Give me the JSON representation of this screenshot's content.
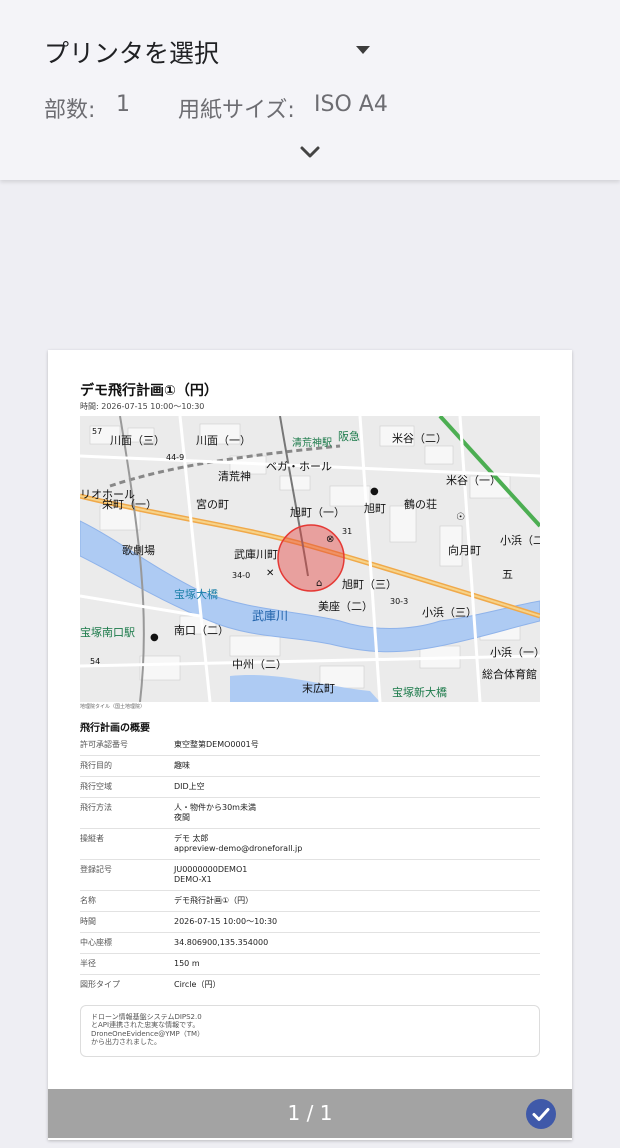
{
  "header": {
    "printer_label": "プリンタを選択",
    "copies_label": "部数:",
    "copies_value": "1",
    "paper_label": "用紙サイズ:",
    "paper_value": "ISO A4"
  },
  "icons": {
    "dropdown": "caret-down-icon",
    "expand": "chevron-down-icon",
    "select": "check-circle-icon"
  },
  "colors": {
    "accent": "#3f59a9",
    "page_bar": "#a3a3a3",
    "flight_area": "#e53935"
  },
  "document": {
    "title": "デモ飛行計画①（円）",
    "time_line": "時間: 2026-07-15 10:00〜10:30",
    "map_credit": "地理院タイル（国土地理院）",
    "map_labels": [
      "川面（三）",
      "川面（一）",
      "米谷（二）",
      "米谷（一）",
      "清荒神",
      "ベガ・ホール",
      "栄町（一）",
      "宮の町",
      "旭町（一）",
      "旭町",
      "鶴の荘",
      "向月町",
      "小浜（二）",
      "小浜（一）",
      "歌劇場",
      "武庫川町",
      "宝塚大橋",
      "旭町（三）",
      "美座（二）",
      "小浜（三）",
      "武庫川",
      "宝塚南口駅",
      "南口（二）",
      "中州（二）",
      "末広町",
      "宝塚新大橋",
      "総合体育館",
      "阪急",
      "清荒神駅",
      "リオホール",
      "31",
      "34-0",
      "30-3",
      "57",
      "44-9",
      "54",
      "五"
    ],
    "summary_title": "飛行計画の概要",
    "rows": [
      {
        "k": "許可承認番号",
        "v": "東空整第DEMO0001号"
      },
      {
        "k": "飛行目的",
        "v": "趣味"
      },
      {
        "k": "飛行空域",
        "v": "DID上空"
      },
      {
        "k": "飛行方法",
        "v": "人・物件から30m未満\n夜間"
      },
      {
        "k": "操縦者",
        "v": "デモ 太郎\nappreview-demo@droneforall.jp"
      },
      {
        "k": "登録記号",
        "v": "JU0000000DEMO1\nDEMO-X1"
      },
      {
        "k": "名称",
        "v": "デモ飛行計画①（円）"
      },
      {
        "k": "時間",
        "v": "2026-07-15 10:00〜10:30"
      },
      {
        "k": "中心座標",
        "v": "34.806900,135.354000"
      },
      {
        "k": "半径",
        "v": "150 m"
      },
      {
        "k": "図形タイプ",
        "v": "Circle（円）"
      }
    ],
    "note": "ドローン情報基盤システムDIPS2.0\nとAPI連携された忠実な情報です。\nDroneOneEvidence@YMP（TM）\nから出力されました。"
  },
  "footer": {
    "page_indicator": "1 / 1"
  }
}
